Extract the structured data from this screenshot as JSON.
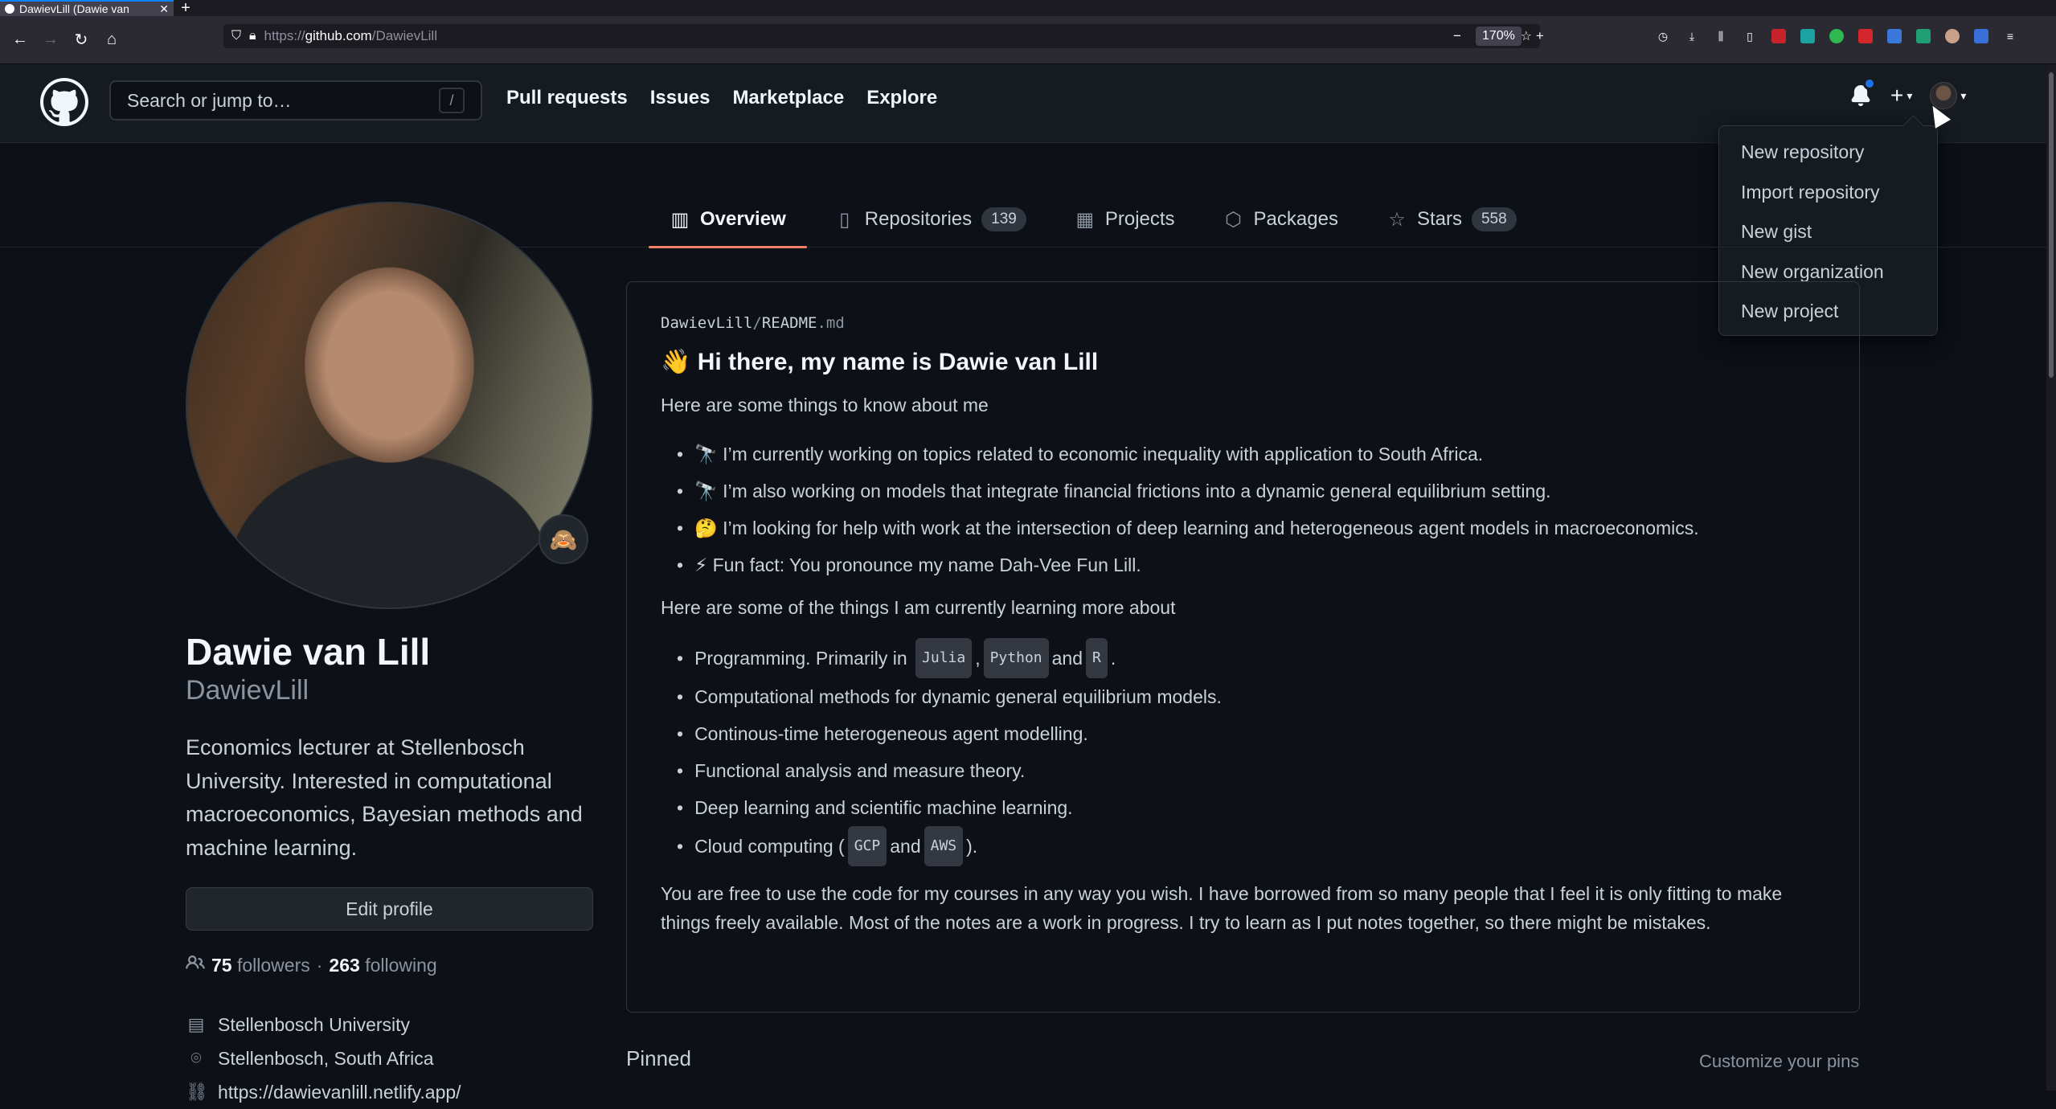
{
  "browser": {
    "tab_title": "DawievLill (Dawie van",
    "url_scheme": "https://",
    "url_host": "github.com",
    "url_path": "/DawievLill",
    "zoom": "170%"
  },
  "header": {
    "search_placeholder": "Search or jump to…",
    "search_shortcut": "/",
    "nav": [
      "Pull requests",
      "Issues",
      "Marketplace",
      "Explore"
    ]
  },
  "create_menu": {
    "items": [
      "New repository",
      "Import repository",
      "New gist",
      "New organization",
      "New project"
    ]
  },
  "profile_tabs": [
    {
      "label": "Overview",
      "icon": "book-icon"
    },
    {
      "label": "Repositories",
      "count": "139",
      "icon": "repo-icon"
    },
    {
      "label": "Projects",
      "icon": "project-icon"
    },
    {
      "label": "Packages",
      "icon": "package-icon"
    },
    {
      "label": "Stars",
      "count": "558",
      "icon": "star-icon"
    }
  ],
  "profile": {
    "status_emoji": "🙈",
    "name": "Dawie van Lill",
    "login": "DawievLill",
    "bio": "Economics lecturer at Stellenbosch University. Interested in computational macroeconomics, Bayesian methods and machine learning.",
    "edit_label": "Edit profile",
    "followers_count": "75",
    "followers_label": "followers",
    "separator": "·",
    "following_count": "263",
    "following_label": "following",
    "organization": "Stellenbosch University",
    "location": "Stellenbosch, South Africa",
    "website": "https://dawievanlill.netlify.app/"
  },
  "readme": {
    "path_user": "DawievLill",
    "path_sep": "/",
    "path_file": "README",
    "path_ext": ".md",
    "heading": "👋 Hi there, my name is Dawie van Lill",
    "intro": "Here are some things to know about me",
    "about_items": [
      "🔭 I’m currently working on topics related to economic inequality with application to South Africa.",
      "🔭 I’m also working on models that integrate financial frictions into a dynamic general equilibrium setting.",
      "🤔 I’m looking for help with work at the intersection of deep learning and heterogeneous agent models in macroeconomics.",
      "⚡ Fun fact: You pronounce my name Dah-Vee Fun Lill."
    ],
    "learning_intro": "Here are some of the things I am currently learning more about",
    "learning_programming_prefix": "Programming. Primarily in",
    "code_julia": "Julia",
    "comma": ",",
    "code_python": "Python",
    "and": "and",
    "code_r": "R",
    "period": ".",
    "learning_items": [
      "Computational methods for dynamic general equilibrium models.",
      "Continous-time heterogeneous agent modelling.",
      "Functional analysis and measure theory.",
      "Deep learning and scientific machine learning."
    ],
    "cloud_prefix": "Cloud computing (",
    "code_gcp": "GCP",
    "code_aws": "AWS",
    "cloud_suffix": ").",
    "closing": "You are free to use the code for my courses in any way you wish. I have borrowed from so many people that I feel it is only fitting to make things freely available. Most of the notes are a work in progress. I try to learn as I put notes together, so there might be mistakes."
  },
  "pinned": {
    "title": "Pinned",
    "customize": "Customize your pins"
  }
}
